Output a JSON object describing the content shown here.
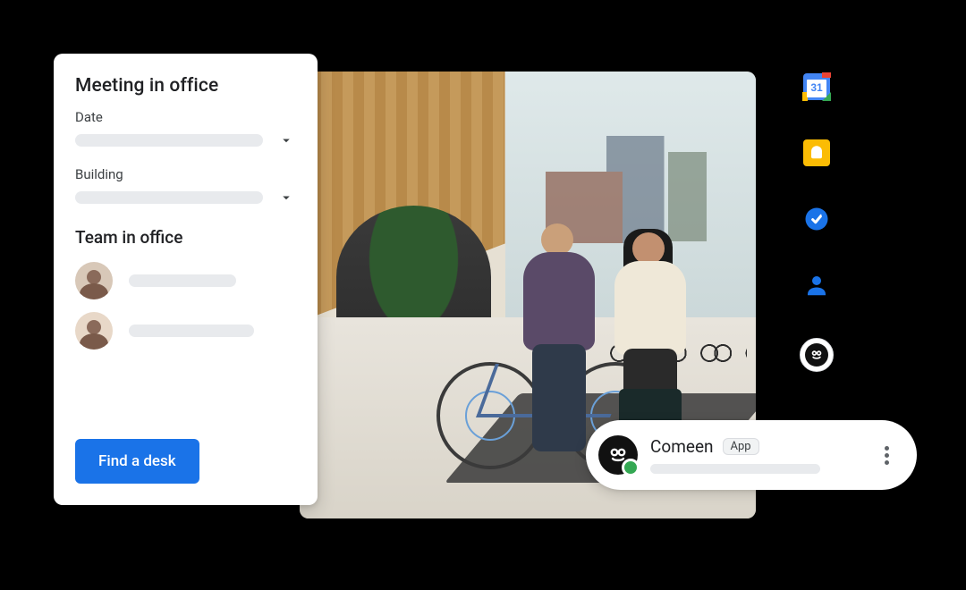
{
  "card": {
    "title": "Meeting in office",
    "date_label": "Date",
    "building_label": "Building",
    "team_header": "Team in office",
    "cta_label": "Find a desk"
  },
  "app_pill": {
    "name": "Comeen",
    "badge": "App"
  },
  "rail": {
    "calendar_day": "31"
  },
  "icons": {
    "calendar": "calendar-icon",
    "keep": "keep-icon",
    "tasks": "tasks-icon",
    "contacts": "contacts-icon",
    "comeen": "comeen-app-icon",
    "chevron_down": "chevron-down-icon",
    "kebab": "more-vert-icon"
  },
  "colors": {
    "primary": "#1a73e8",
    "google_blue": "#4285f4",
    "google_green": "#34a853",
    "google_yellow": "#fbbc04",
    "google_red": "#ea4335",
    "placeholder_grey": "#e8eaed"
  }
}
